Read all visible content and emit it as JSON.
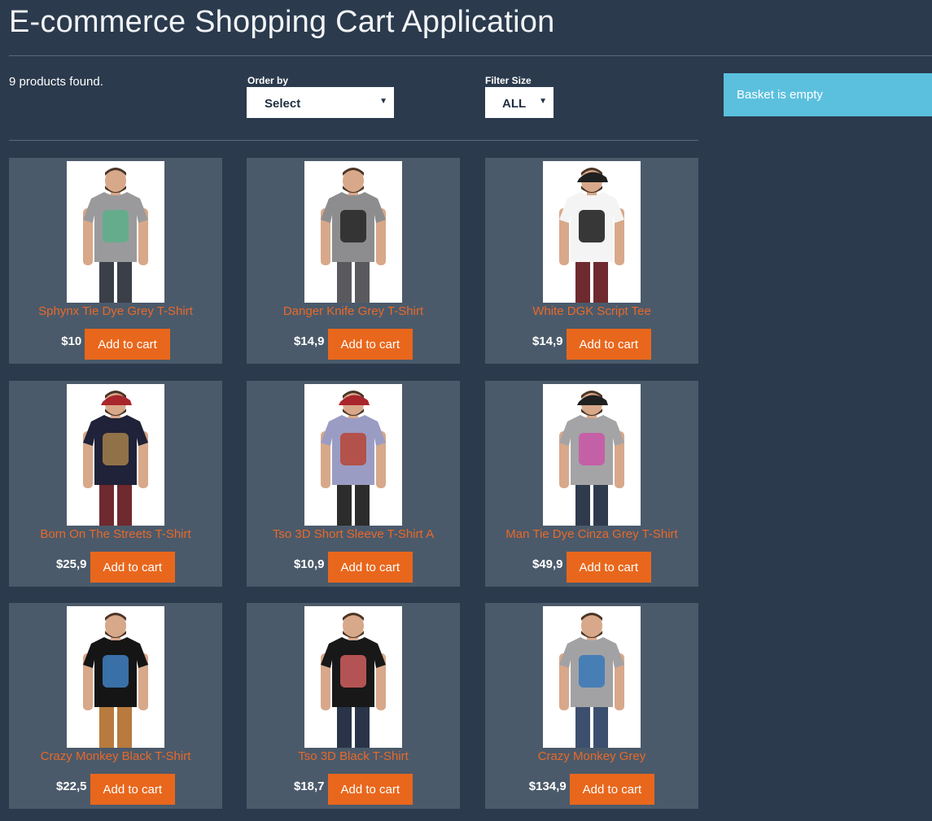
{
  "header": {
    "title": "E-commerce Shopping Cart Application"
  },
  "toolbar": {
    "found_text": "9 products found.",
    "order_by": {
      "label": "Order by",
      "selected": "Select"
    },
    "filter_size": {
      "label": "Filter Size",
      "selected": "ALL"
    }
  },
  "basket": {
    "status": "Basket is empty"
  },
  "products": [
    {
      "name": "Sphynx Tie Dye Grey T-Shirt",
      "price": "$10",
      "button": "Add to cart",
      "shirt_color": "#9a9a9c",
      "print_color": "#5fae8c",
      "pants_color": "#3a3f48",
      "hat": "none"
    },
    {
      "name": "Danger Knife Grey T-Shirt",
      "price": "$14,9",
      "button": "Add to cart",
      "shirt_color": "#8d8d8f",
      "print_color": "#2a2a2a",
      "pants_color": "#5a5a5e",
      "hat": "none"
    },
    {
      "name": "White DGK Script Tee",
      "price": "$14,9",
      "button": "Add to cart",
      "shirt_color": "#f4f4f4",
      "print_color": "#222222",
      "pants_color": "#6e2a2e",
      "hat": "black"
    },
    {
      "name": "Born On The Streets T-Shirt",
      "price": "$25,9",
      "button": "Add to cart",
      "shirt_color": "#1f2238",
      "print_color": "#9c7a4a",
      "pants_color": "#6e2a2e",
      "hat": "red"
    },
    {
      "name": "Tso 3D Short Sleeve T-Shirt A",
      "price": "$10,9",
      "button": "Add to cart",
      "shirt_color": "#9b9cc4",
      "print_color": "#b54a3e",
      "pants_color": "#2c2c2c",
      "hat": "red"
    },
    {
      "name": "Man Tie Dye Cinza Grey T-Shirt",
      "price": "$49,9",
      "button": "Add to cart",
      "shirt_color": "#a4a4a6",
      "print_color": "#c85aa6",
      "pants_color": "#2f3a4d",
      "hat": "black"
    },
    {
      "name": "Crazy Monkey Black T-Shirt",
      "price": "$22,5",
      "button": "Add to cart",
      "shirt_color": "#151515",
      "print_color": "#3e7ab8",
      "pants_color": "#b87a3e",
      "hat": "none"
    },
    {
      "name": "Tso 3D Black T-Shirt",
      "price": "$18,7",
      "button": "Add to cart",
      "shirt_color": "#181818",
      "print_color": "#c55a5a",
      "pants_color": "#2a3448",
      "hat": "none"
    },
    {
      "name": "Crazy Monkey Grey",
      "price": "$134,9",
      "button": "Add to cart",
      "shirt_color": "#a2a2a4",
      "print_color": "#3e7ab8",
      "pants_color": "#3d4f6e",
      "hat": "none"
    }
  ]
}
